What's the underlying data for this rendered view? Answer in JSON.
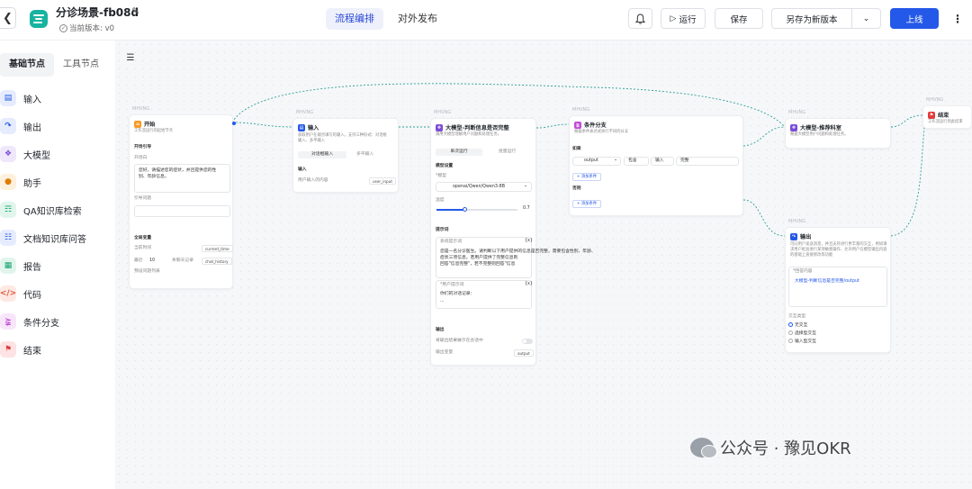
{
  "header": {
    "back_icon": "chevron-left-icon",
    "logo_icon": "list-icon",
    "app_title": "分诊场景-fb08d",
    "edit_icon": "pencil-icon",
    "version_label": "当前版本: v0",
    "tabs": [
      {
        "label": "流程编排",
        "active": true
      },
      {
        "label": "对外发布",
        "active": false
      }
    ],
    "bell_icon": "bell-icon",
    "run_label": "运行",
    "save_label": "保存",
    "save_as_label": "另存为新版本",
    "publish_label": "上线",
    "more_icon": "more-vertical-icon",
    "accent_color": "#2458e8"
  },
  "sidebar": {
    "tabs": [
      {
        "label": "基础节点",
        "active": true
      },
      {
        "label": "工具节点",
        "active": false
      }
    ],
    "items": [
      {
        "label": "输入",
        "icon": "input-icon",
        "color": "#2458e8",
        "bg": "#e6ecfd"
      },
      {
        "label": "输出",
        "icon": "output-icon",
        "color": "#2458e8",
        "bg": "#e6ecfd"
      },
      {
        "label": "大模型",
        "icon": "llm-icon",
        "color": "#7b4dd8",
        "bg": "#efe8fb"
      },
      {
        "label": "助手",
        "icon": "assistant-icon",
        "color": "#e07b00",
        "bg": "#fdf0dc"
      },
      {
        "label": "QA知识库检索",
        "icon": "qa-kb-icon",
        "color": "#12a46b",
        "bg": "#e1f5ec"
      },
      {
        "label": "文档知识库问答",
        "icon": "doc-kb-icon",
        "color": "#2458e8",
        "bg": "#e6ecfd"
      },
      {
        "label": "报告",
        "icon": "report-icon",
        "color": "#12a46b",
        "bg": "#e1f5ec"
      },
      {
        "label": "代码",
        "icon": "code-icon",
        "color": "#e2583e",
        "bg": "#fde9e4"
      },
      {
        "label": "条件分支",
        "icon": "branch-icon",
        "color": "#c24bd6",
        "bg": "#f7e6fa"
      },
      {
        "label": "结束",
        "icon": "flag-icon",
        "color": "#e23b3b",
        "bg": "#fde3e3"
      }
    ]
  },
  "canvas": {
    "collapse_icon": "collapse-sidebar-icon",
    "start": {
      "id": "MHVNG",
      "title": "开始",
      "desc": "工作流运行的起始节点",
      "opening_section": "开场引导",
      "opening_label": "开场白",
      "opening_text_1": "您好，请描述您的症状，并且提供您的性",
      "opening_text_2": "别、年龄信息。",
      "guide_label": "引导问题",
      "global_section": "全局变量",
      "current_time_label": "当前时间",
      "current_time_var": "current_time",
      "recent_label": "最近",
      "recent_count": "10",
      "recent_unit": "条聊天记录",
      "chat_history_var": "chat_history",
      "preset_label": "预设问题列表"
    },
    "input": {
      "id": "MHVNG",
      "title": "输入",
      "desc_1": "获取用户在端点填写的输入，支持三种形式：对话框",
      "desc_2": "输入、多平输入",
      "mode_dialog": "对话框输入",
      "mode_multi": "多平输入",
      "section": "输入",
      "field_label": "用户输入的内容",
      "var": "user_input"
    },
    "llm_judge": {
      "id": "MHVNG",
      "title": "大模型-判断信息是否完整",
      "desc": "调用大模型理解用户问题和处理任务。",
      "mode_single": "单次运行",
      "mode_batch": "批量运行",
      "model_section": "模型设置",
      "model_label": "*模型",
      "model_value": "openai/Qwen/Qwen3-8B",
      "temp_label": "温度",
      "temp_value": "0.7",
      "temperature": 0.7,
      "prompt_section": "提示词",
      "sys_label": "系统提示词",
      "sys_text": [
        "您是一名分诊医生。请判断以下用户提供的信息是否完整，需要包含性别、年龄、",
        "症状三项信息。若用户提供了完整信息则",
        "回答\"信息完整\"，若不完整则回答\"信息"
      ],
      "user_label": "*用户提示词",
      "user_text": "你们的对话记录：",
      "user_text_2": "...",
      "output_section": "输出",
      "stream_label": "将输出结果展示在会话中",
      "output_var_label": "输出变量",
      "output_var": "output"
    },
    "branch": {
      "id": "MHVNG",
      "title": "条件分支",
      "desc": "根据条件表达式执行不同的分支",
      "if_label": "如果",
      "var": "output",
      "op": "包含",
      "type": "输入",
      "value": "完整",
      "add_condition": "+ 添加条件",
      "else_label": "否则",
      "add_condition_2": "+ 添加条件"
    },
    "llm_recommend": {
      "id": "MHVNG",
      "title": "大模型-推荐科室",
      "desc": "根据大模型用户问题和处理任务。"
    },
    "end": {
      "id": "MHVNG",
      "title": "结束",
      "desc": "工作流运行到此结束"
    },
    "output": {
      "id": "MHVNG",
      "title": "输出",
      "desc_1": "可向用户发送消息，并且支持进行更丰富的交互，例如请",
      "desc_2": "求用户批准进行某项敏感操作、允许用户在模型输出内容",
      "desc_3": "的基础上直接修改等功能",
      "content_label": "*回答内容",
      "content_value": "大模型-判断信息是否完整/output",
      "interact_label": "交互类型",
      "options": [
        "无交互",
        "选择型交互",
        "输入型交互"
      ],
      "selected": 0
    }
  },
  "watermark": {
    "icon": "wechat-icon",
    "text": "公众号 · 豫见OKR"
  }
}
